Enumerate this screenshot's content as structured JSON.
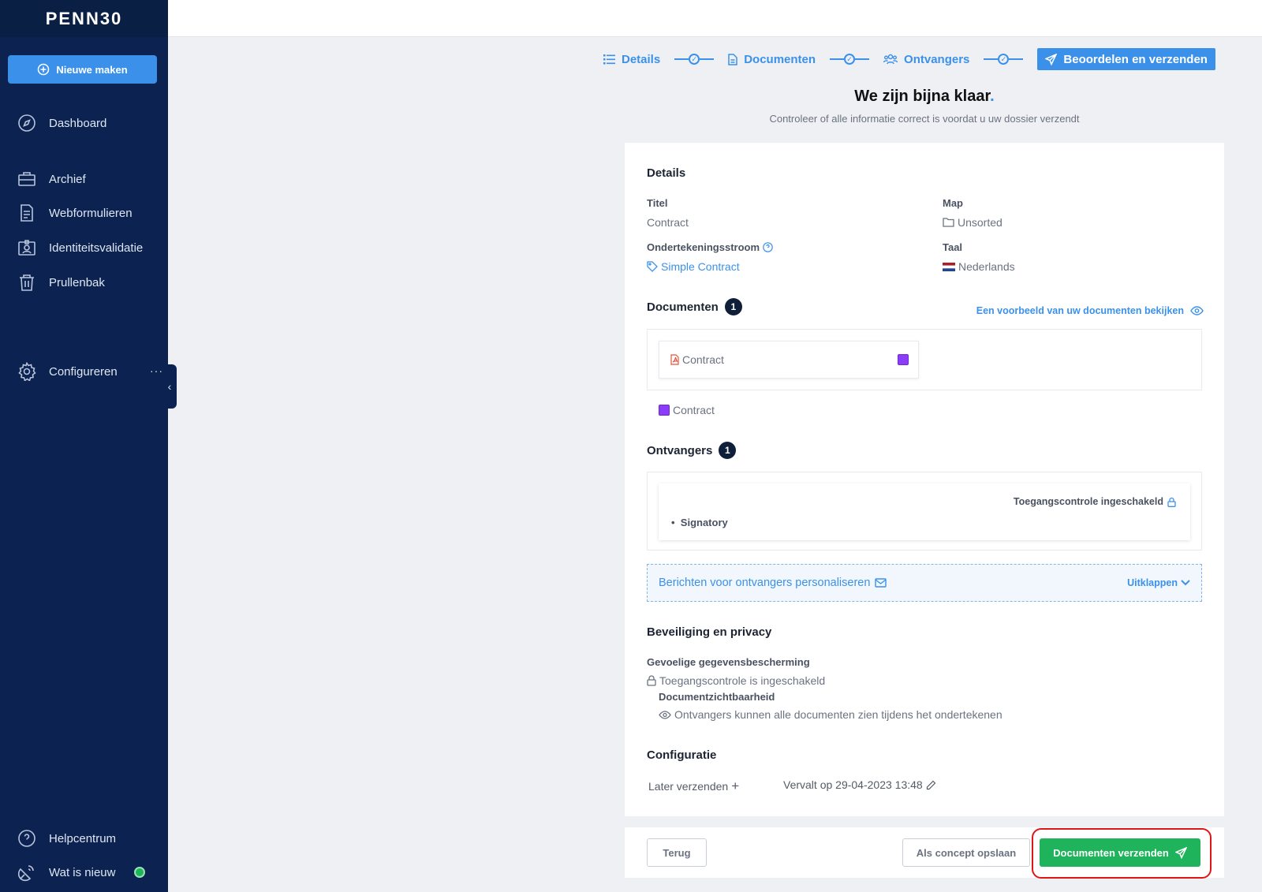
{
  "brand": "PENN30",
  "sidebar": {
    "new_button": "Nieuwe maken",
    "items": [
      {
        "label": "Dashboard",
        "icon": "compass-icon"
      },
      {
        "label": "Archief",
        "icon": "briefcase-icon"
      },
      {
        "label": "Webformulieren",
        "icon": "document-icon"
      },
      {
        "label": "Identiteitsvalidatie",
        "icon": "id-badge-icon"
      },
      {
        "label": "Prullenbak",
        "icon": "trash-icon"
      },
      {
        "label": "Configureren",
        "icon": "gear-icon"
      },
      {
        "label": "Helpcentrum",
        "icon": "help-icon"
      },
      {
        "label": "Wat is nieuw",
        "icon": "satellite-icon"
      }
    ],
    "more": "···"
  },
  "stepper": {
    "steps": [
      "Details",
      "Documenten",
      "Ontvangers",
      "Beoordelen en verzenden"
    ]
  },
  "page": {
    "title": "We zijn bijna klaar",
    "title_dot": ".",
    "subtitle": "Controleer of alle informatie correct is voordat u uw dossier verzendt"
  },
  "details": {
    "heading": "Details",
    "title_label": "Titel",
    "title_value": "Contract",
    "folder_label": "Map",
    "folder_value": "Unsorted",
    "flow_label": "Ondertekeningsstroom",
    "flow_value": "Simple Contract",
    "language_label": "Taal",
    "language_value": "Nederlands"
  },
  "documents": {
    "heading": "Documenten",
    "count": "1",
    "preview_link": "Een voorbeeld van uw documenten bekijken",
    "items": [
      "Contract"
    ],
    "legend": "Contract",
    "color": "#8b3cf7"
  },
  "recipients": {
    "heading": "Ontvangers",
    "count": "1",
    "access_control": "Toegangscontrole ingeschakeld",
    "role": "Signatory",
    "personalize": "Berichten voor ontvangers personaliseren",
    "expand": "Uitklappen"
  },
  "security": {
    "heading": "Beveiliging en privacy",
    "sensitive_label": "Gevoelige gegevensbescherming",
    "sensitive_value": "Toegangscontrole is ingeschakeld",
    "visibility_label": "Documentzichtbaarheid",
    "visibility_value": "Ontvangers kunnen alle documenten zien tijdens het ondertekenen"
  },
  "configuration": {
    "heading": "Configuratie",
    "send_later": "Later verzenden",
    "expires": "Vervalt op 29-04-2023 13:48"
  },
  "footer": {
    "back": "Terug",
    "save_draft": "Als concept opslaan",
    "send": "Documenten verzenden"
  },
  "colors": {
    "sidebar": "#0c2351",
    "accent": "#3b91ea",
    "send": "#1fb45c",
    "highlight": "#e01515"
  }
}
